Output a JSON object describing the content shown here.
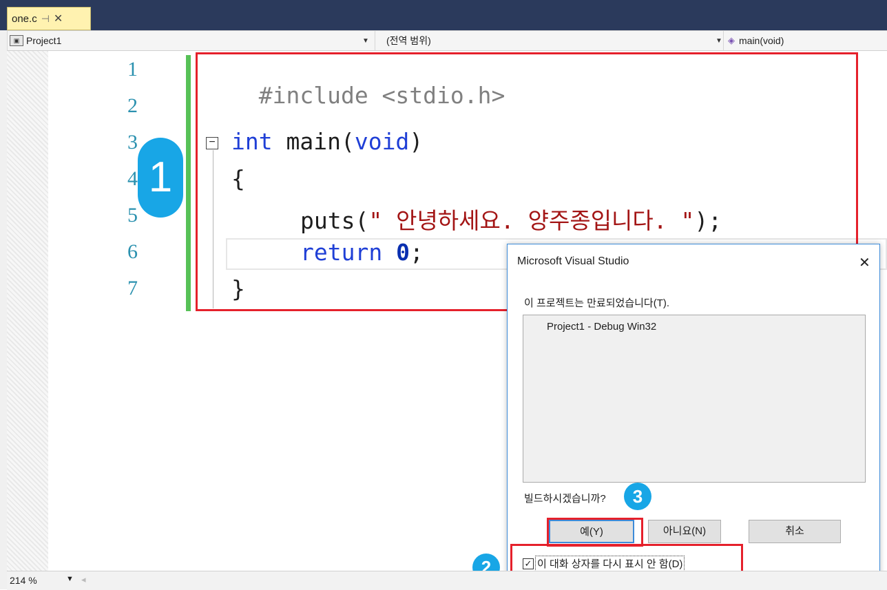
{
  "tab": {
    "filename": "one.c",
    "pin_glyph": "⊣",
    "close_glyph": "✕"
  },
  "nav": {
    "project": "Project1",
    "scope": "(전역 범위)",
    "function": "main(void)"
  },
  "editor": {
    "line_numbers": [
      "1",
      "2",
      "3",
      "4",
      "5",
      "6",
      "7"
    ],
    "code": {
      "l1_pp": "#include <stdio.h>",
      "l3_kw_int": "int",
      "l3_main": " main(",
      "l3_kw_void": "void",
      "l3_close": ")",
      "l4": "{",
      "l5_fn": "puts(",
      "l5_str": "\" 안녕하세요. 양주종입니다. \"",
      "l5_end": ");",
      "l6_kw": "return",
      "l6_num": "0",
      "l6_end": ";",
      "l7": "}"
    },
    "collapse_glyph": "−"
  },
  "annotations": {
    "badge1": "1",
    "badge2": "2",
    "badge3": "3"
  },
  "dialog": {
    "title": "Microsoft Visual Studio",
    "close_glyph": "✕",
    "message": "이 프로젝트는 만료되었습니다(T).",
    "list_items": [
      "Project1 - Debug Win32"
    ],
    "question": "빌드하시겠습니까?",
    "buttons": {
      "yes": "예(Y)",
      "no": "아니요(N)",
      "cancel": "취소"
    },
    "checkbox_label": "이 대화 상자를 다시 표시 안 함(D)",
    "checkbox_checked": true
  },
  "status": {
    "zoom": "214 %"
  },
  "colors": {
    "accent_red": "#e5202b",
    "badge_blue": "#18a6e6",
    "change_green": "#57c157"
  }
}
